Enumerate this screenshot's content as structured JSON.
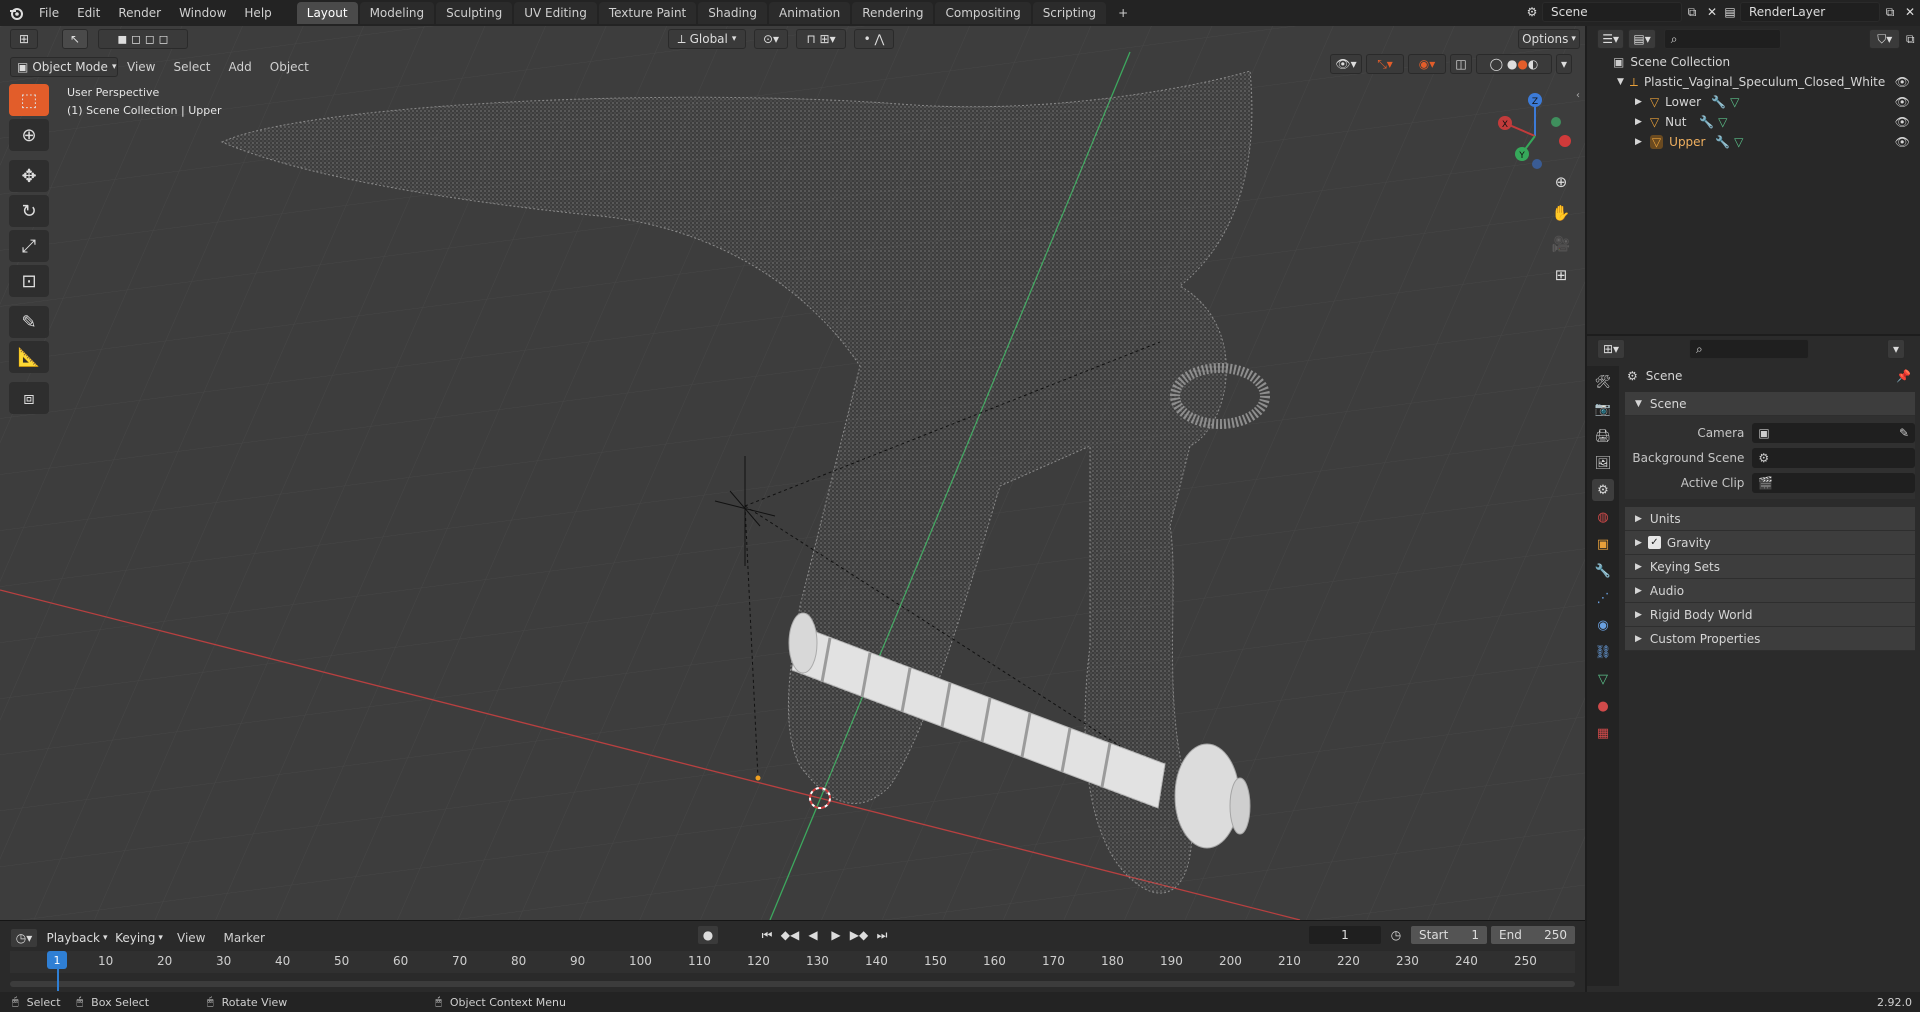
{
  "menu": [
    "File",
    "Edit",
    "Render",
    "Window",
    "Help"
  ],
  "workspaces": [
    "Layout",
    "Modeling",
    "Sculpting",
    "UV Editing",
    "Texture Paint",
    "Shading",
    "Animation",
    "Rendering",
    "Compositing",
    "Scripting"
  ],
  "active_workspace": "Layout",
  "add_workspace": "+",
  "scene_name": "Scene",
  "view_layer": "RenderLayer",
  "header": {
    "mode": "Object Mode",
    "view": "View",
    "select": "Select",
    "add": "Add",
    "object": "Object",
    "transform": "Global",
    "options": "Options"
  },
  "viewport": {
    "perspective": "User Perspective",
    "collection": "(1) Scene Collection | Upper"
  },
  "gizmo": {
    "x": "X",
    "y": "Y",
    "z": "Z"
  },
  "outliner": {
    "root": "Scene Collection",
    "object": "Plastic_Vaginal_Speculum_Closed_White",
    "children": [
      "Lower",
      "Nut",
      "Upper"
    ]
  },
  "properties": {
    "context": "Scene",
    "panel": "Scene",
    "camera_label": "Camera",
    "bg_scene_label": "Background Scene",
    "active_clip_label": "Active Clip",
    "sections": [
      "Units",
      "Gravity",
      "Keying Sets",
      "Audio",
      "Rigid Body World",
      "Custom Properties"
    ]
  },
  "timeline": {
    "playback": "Playback",
    "keying": "Keying",
    "view": "View",
    "marker": "Marker",
    "current_frame": "1",
    "start_label": "Start",
    "start": "1",
    "end_label": "End",
    "end": "250",
    "ticks": [
      "10",
      "20",
      "30",
      "40",
      "50",
      "60",
      "70",
      "80",
      "90",
      "100",
      "110",
      "120",
      "130",
      "140",
      "150",
      "160",
      "170",
      "180",
      "190",
      "200",
      "210",
      "220",
      "230",
      "240",
      "250"
    ],
    "playhead": "1"
  },
  "status": {
    "select": "Select",
    "box_select": "Box Select",
    "rotate": "Rotate View",
    "context_menu": "Object Context Menu",
    "version": "2.92.0"
  },
  "colors": {
    "accent": "#e25d2a",
    "x_axis": "#c33b3b",
    "y_axis": "#36a85a",
    "z_axis": "#3c7bd8"
  }
}
